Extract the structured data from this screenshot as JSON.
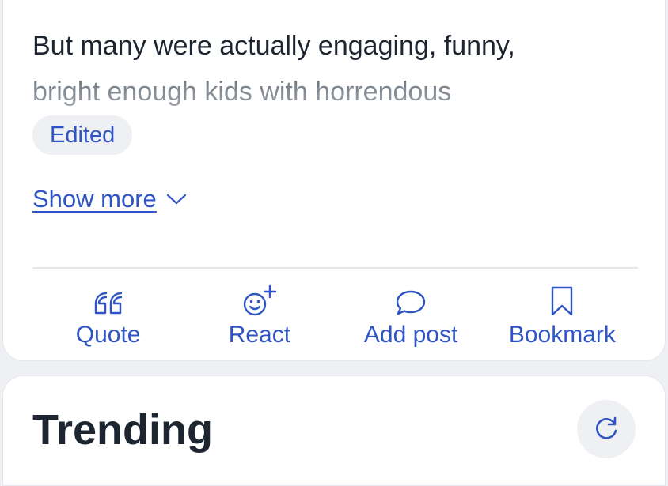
{
  "post": {
    "text_line1": "But many were actually engaging, funny,",
    "text_line2": "bright enough kids with horrendous",
    "edited_badge": "Edited",
    "show_more": "Show more"
  },
  "actions": [
    {
      "label": "Quote",
      "icon": "quote-icon"
    },
    {
      "label": "React",
      "icon": "smiley-plus-icon"
    },
    {
      "label": "Add post",
      "icon": "speech-bubble-icon"
    },
    {
      "label": "Bookmark",
      "icon": "bookmark-icon"
    }
  ],
  "trending": {
    "title": "Trending",
    "refresh_icon": "refresh-icon"
  },
  "colors": {
    "accent": "#2f55c4",
    "text": "#1c2530",
    "background": "#eef0f3"
  }
}
